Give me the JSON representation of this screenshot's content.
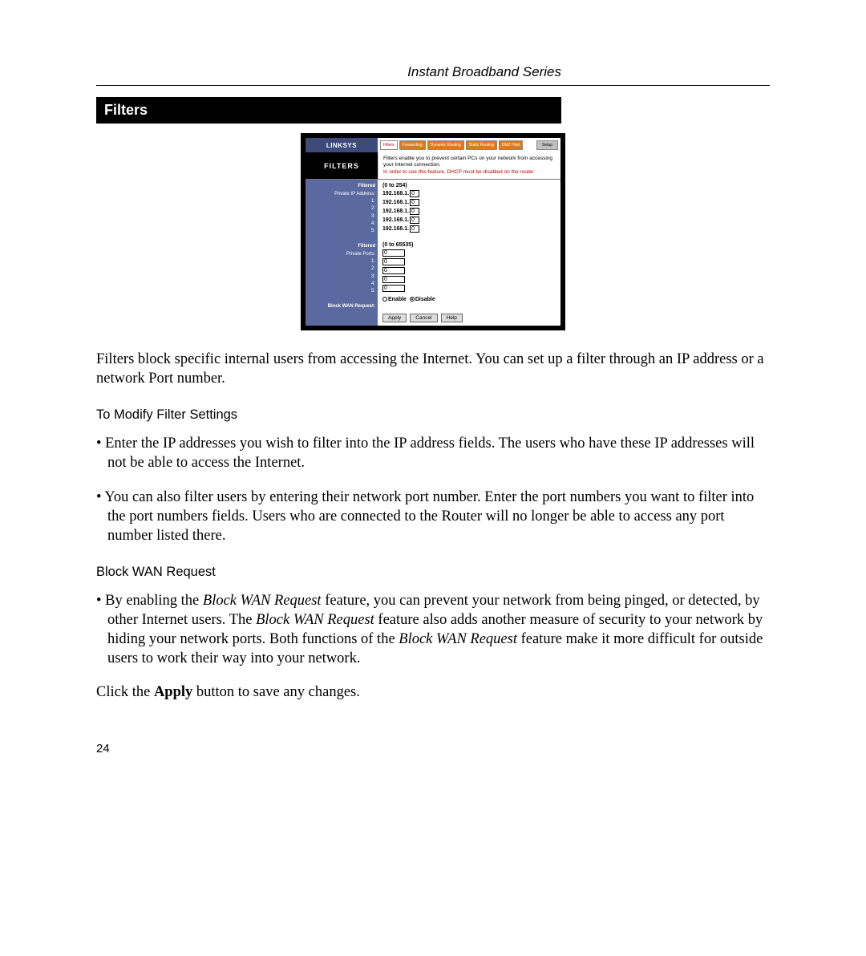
{
  "header": {
    "series": "Instant Broadband Series",
    "section_title": "Filters"
  },
  "screenshot": {
    "brand": "LINKSYS",
    "tabs": {
      "active": "Filters",
      "t2": "Forwarding",
      "t3": "Dynamic Routing",
      "t4": "Static Routing",
      "t5": "DMZ Host",
      "t6": "Setup"
    },
    "panel_title": "FILTERS",
    "desc_line1": "Filters enable you to prevent certain PCs on your network from accessing your Internet connection.",
    "desc_red": "In order to use this feature, DHCP must be disabled on the router.",
    "labels": {
      "ip_hdr": "Filtered",
      "ip_sub": "Private IP Address:",
      "port_hdr": "Filtered",
      "port_sub": "Private Ports:",
      "wan": "Block WAN Request:",
      "n1": "1:",
      "n2": "2:",
      "n3": "3:",
      "n4": "4:",
      "n5": "5:"
    },
    "ip_range": "(0 to 254)",
    "ip_prefix": "192.168.1.",
    "ip_values": [
      "0",
      "0",
      "0",
      "0",
      "0"
    ],
    "port_range": "(0 to 65535)",
    "port_values": [
      "0",
      "0",
      "0",
      "0",
      "0"
    ],
    "wan": {
      "enable": "Enable",
      "disable": "Disable",
      "selected": "disable"
    },
    "buttons": {
      "apply": "Apply",
      "cancel": "Cancel",
      "help": "Help"
    }
  },
  "body": {
    "intro": "Filters block specific internal users from accessing the Internet. You can set up a filter through an IP address or a network Port number.",
    "h_modify": "To Modify Filter Settings",
    "bullet1": "Enter the IP addresses you wish to filter into the IP address fields. The users who have these IP addresses will not be able to access the Internet.",
    "bullet2": "You can also filter users by entering their network port number. Enter the port numbers you want to filter into the port numbers fields. Users who are connected to the Router will no longer be able to access any port number listed there.",
    "h_block": "Block WAN Request",
    "bullet3_a": "By enabling the ",
    "bullet3_i1": "Block WAN Request",
    "bullet3_b": " feature, you can prevent your network from being pinged, or detected, by other Internet users. The ",
    "bullet3_i2": "Block WAN Request",
    "bullet3_c": " feature also adds another measure of security to your network by hiding your network ports. Both functions of the ",
    "bullet3_i3": "Block WAN Request",
    "bullet3_d": " feature make it more difficult for outside users to work their way into your network.",
    "closing_a": "Click the ",
    "closing_b": "Apply",
    "closing_c": " button to save any changes."
  },
  "page_number": "24"
}
